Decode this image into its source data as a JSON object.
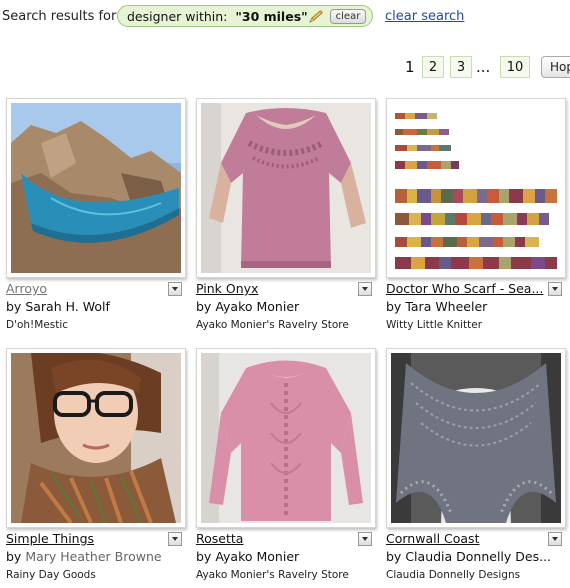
{
  "search": {
    "label": "Search results for",
    "filter_prefix": "designer within:",
    "filter_value": "\"30 miles\"",
    "clear_label": "clear",
    "clear_search_label": "clear search"
  },
  "pager": {
    "current": "1",
    "pages": [
      "2",
      "3"
    ],
    "ellipsis": "...",
    "last": "10",
    "hop_label": "Hop"
  },
  "patterns": [
    {
      "title": "Arroyo",
      "by": "by",
      "designer": "Sarah H. Wolf",
      "store": "D'oh!Mestic"
    },
    {
      "title": "Pink Onyx",
      "by": "by",
      "designer": "Ayako Monier",
      "store": "Ayako Monier's Ravelry Store"
    },
    {
      "title": "Doctor Who Scarf - Sea...",
      "by": "by",
      "designer": "Tara Wheeler",
      "store": "Witty Little Knitter"
    },
    {
      "title": "Simple Things",
      "by": "by",
      "designer": "Mary Heather Browne",
      "store": "Rainy Day Goods"
    },
    {
      "title": "Rosetta",
      "by": "by",
      "designer": "Ayako Monier",
      "store": "Ayako Monier's Ravelry Store"
    },
    {
      "title": "Cornwall Coast",
      "by": "by",
      "designer": "Claudia Donnelly Des...",
      "store": "Claudia Donnelly Designs"
    }
  ],
  "colors": {
    "link": "#1a4ea0",
    "pill_bg": "#e6f4d4",
    "pill_border": "#9ec67c"
  }
}
